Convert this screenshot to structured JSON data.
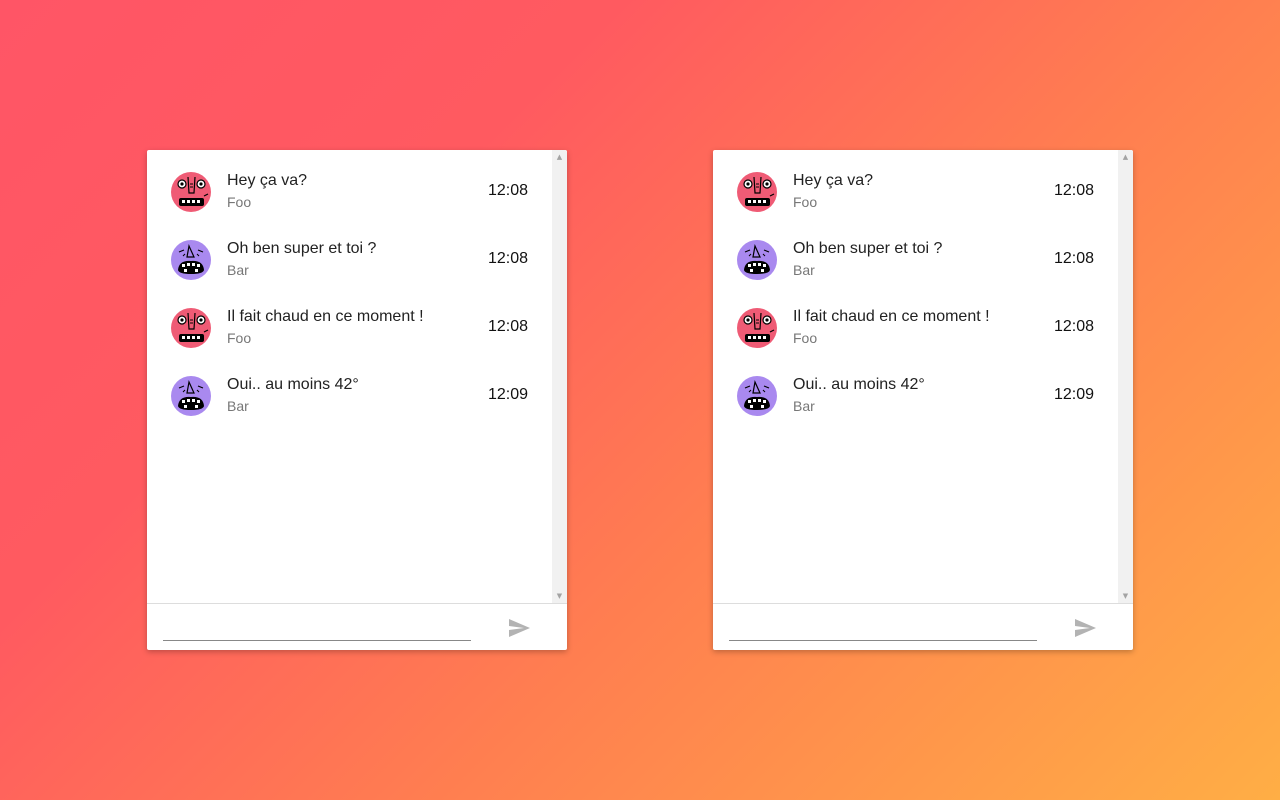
{
  "colors": {
    "foo_avatar": "#ef5b75",
    "bar_avatar": "#a989ef",
    "send_icon": "#b3b3b3"
  },
  "chats": [
    {
      "messages": [
        {
          "text": "Hey ça va?",
          "author": "Foo",
          "time": "12:08",
          "avatar": "monster-face-red-icon"
        },
        {
          "text": "Oh ben super et toi ?",
          "author": "Bar",
          "time": "12:08",
          "avatar": "monster-face-purple-icon"
        },
        {
          "text": "Il fait chaud en ce moment !",
          "author": "Foo",
          "time": "12:08",
          "avatar": "monster-face-red-icon"
        },
        {
          "text": "Oui.. au moins 42°",
          "author": "Bar",
          "time": "12:09",
          "avatar": "monster-face-purple-icon"
        }
      ],
      "input": {
        "value": "",
        "placeholder": ""
      }
    },
    {
      "messages": [
        {
          "text": "Hey ça va?",
          "author": "Foo",
          "time": "12:08",
          "avatar": "monster-face-red-icon"
        },
        {
          "text": "Oh ben super et toi ?",
          "author": "Bar",
          "time": "12:08",
          "avatar": "monster-face-purple-icon"
        },
        {
          "text": "Il fait chaud en ce moment !",
          "author": "Foo",
          "time": "12:08",
          "avatar": "monster-face-red-icon"
        },
        {
          "text": "Oui.. au moins 42°",
          "author": "Bar",
          "time": "12:09",
          "avatar": "monster-face-purple-icon"
        }
      ],
      "input": {
        "value": "",
        "placeholder": ""
      }
    }
  ]
}
